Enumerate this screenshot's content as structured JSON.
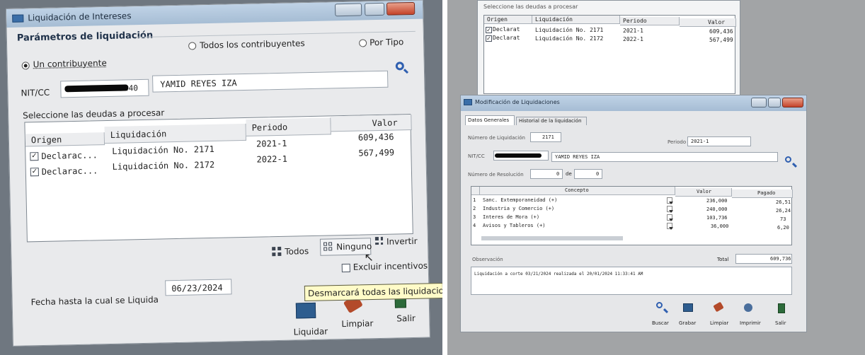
{
  "left_window": {
    "title": "Liquidación de Intereses",
    "group_title": "Parámetros de liquidación",
    "radio_all": "Todos los contribuyentes",
    "radio_by_type": "Por Tipo",
    "radio_one": "Un contribuyente",
    "nit_label": "NIT/CC",
    "nit_value_visible": "2440",
    "taxpayer_name": "YAMID REYES IZA",
    "debts_label": "Seleccione las deudas a procesar",
    "columns": [
      "Origen",
      "Liquidación",
      "Periodo",
      "Valor"
    ],
    "rows": [
      {
        "checked": true,
        "origin": "Declarac...",
        "liquidation": "Liquidación No. 2171",
        "period": "2021-1",
        "value": "609,436"
      },
      {
        "checked": true,
        "origin": "Declarac...",
        "liquidation": "Liquidación No. 2172",
        "period": "2022-1",
        "value": "567,499"
      }
    ],
    "btn_all": "Todos",
    "btn_none": "Ninguno",
    "btn_invert": "Invertir",
    "exclude_incentives": "Excluir incentivos",
    "date_label": "Fecha hasta la cual se Liquida",
    "date_value": "06/23/2024",
    "tooltip": "Desmarcará todas las liquidaciones",
    "btn_liquidate": "Liquidar",
    "btn_clean": "Limpiar",
    "btn_exit": "Salir"
  },
  "bg_window": {
    "debts_label": "Seleccione las deudas a procesar",
    "columns": [
      "Origen",
      "Liquidación",
      "Periodo",
      "Valor"
    ],
    "rows": [
      {
        "checked": true,
        "origin": "Declarat",
        "liquidation": "Liquidación No. 2171",
        "period": "2021-1",
        "value": "609,436"
      },
      {
        "checked": true,
        "origin": "Declarat",
        "liquidation": "Liquidación No. 2172",
        "period": "2022-1",
        "value": "567,499"
      }
    ]
  },
  "right_window": {
    "title": "Modificación de Liquidaciones",
    "tab_general": "Datos Generales",
    "tab_history": "Historial de la liquidación",
    "liq_number_label": "Número de Liquidación",
    "liq_number_value": "2171",
    "period_label": "Periodo",
    "period_value": "2021-1",
    "nit_label": "NIT/CC",
    "taxpayer_name": "YAMID REYES IZA",
    "resolution_label": "Número de Resolución",
    "resolution_value": "0",
    "resolution_of": "de",
    "resolution_total": "0",
    "columns": [
      "Concepto",
      "Valor",
      "Pagado"
    ],
    "rows": [
      {
        "n": "1",
        "concept": "Sanc. Extemporaneidad (+)",
        "value": "236,000",
        "paid": "26,51"
      },
      {
        "n": "2",
        "concept": "Industria y Comercio (+)",
        "value": "240,000",
        "paid": "26,24"
      },
      {
        "n": "3",
        "concept": "Interes de Mora (+)",
        "value": "103,736",
        "paid": "73"
      },
      {
        "n": "4",
        "concept": "Avisos y Tableros (+)",
        "value": "36,000",
        "paid": "6,20"
      }
    ],
    "observation_label": "Observación",
    "total_label": "Total",
    "total_value": "609,736",
    "observation_text": "Liquidación a corte 03/21/2024 realizada el 20/01/2024 11:33:41 AM",
    "btn_search": "Buscar",
    "btn_save": "Grabar",
    "btn_clean": "Limpiar",
    "btn_print": "Imprimir",
    "btn_exit": "Salir"
  }
}
